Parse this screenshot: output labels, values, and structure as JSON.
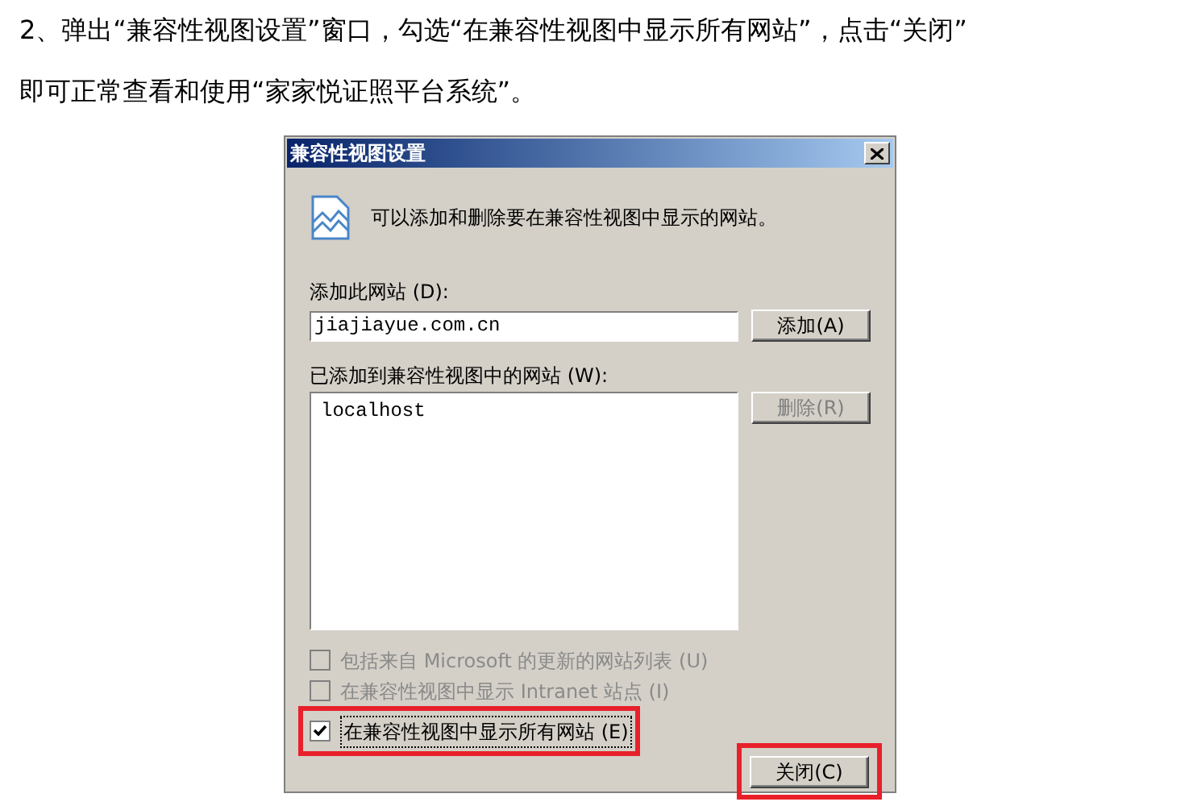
{
  "instruction_lines": [
    "2、弹出“兼容性视图设置”窗口，勾选“在兼容性视图中显示所有网站”，点击“关闭”",
    "即可正常查看和使用“家家悦证照平台系统”。"
  ],
  "dialog": {
    "title": "兼容性视图设置",
    "description": "可以添加和删除要在兼容性视图中显示的网站。",
    "add_label": "添加此网站 (D):",
    "add_input": {
      "value": "jiajiayue.com.cn"
    },
    "add_button": {
      "label": "添加(A)",
      "disabled": false
    },
    "list_label": "已添加到兼容性视图中的网站 (W):",
    "list_items": [
      "localhost"
    ],
    "delete_button": {
      "label": "删除(R)",
      "disabled": true
    },
    "options": [
      {
        "label": "包括来自 Microsoft 的更新的网站列表 (U)",
        "checked": false,
        "disabled": true,
        "highlighted": false
      },
      {
        "label": "在兼容性视图中显示 Intranet 站点 (I)",
        "checked": false,
        "disabled": true,
        "highlighted": false
      },
      {
        "label": "在兼容性视图中显示所有网站 (E)",
        "checked": true,
        "disabled": false,
        "highlighted": true
      }
    ],
    "close_button": {
      "label": "关闭(C)",
      "highlighted": true
    }
  }
}
